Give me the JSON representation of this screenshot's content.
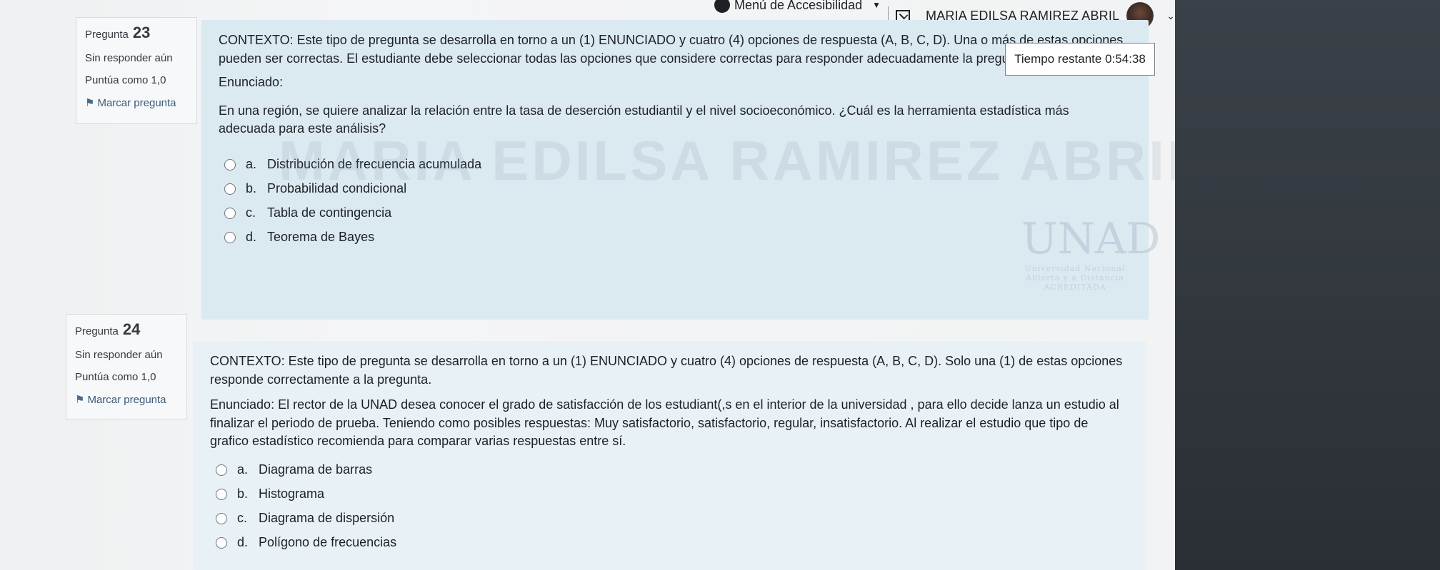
{
  "topbar": {
    "accessibility_menu": "Menú de Accesibilidad",
    "user_name": "MARIA EDILSA RAMIREZ ABRIL"
  },
  "timer": {
    "label": "Tiempo restante",
    "value": "0:54:38"
  },
  "watermark": "MARIA EDILSA RAMIREZ ABRIL",
  "logo": {
    "name": "UNAD",
    "line1": "Universidad Nacional",
    "line2": "Abierta y a Distancia",
    "badge": "ACREDITADA"
  },
  "questions": [
    {
      "label": "Pregunta",
      "number": "23",
      "status": "Sin responder aún",
      "score": "Puntúa como 1,0",
      "flag": "Marcar pregunta",
      "context": "CONTEXTO: Este tipo de pregunta se desarrolla en torno a un (1) ENUNCIADO y cuatro (4) opciones de respuesta (A, B, C, D). Una o más de estas opciones pueden ser correctas. El estudiante debe seleccionar todas las opciones que considere correctas para responder adecuadamente la pregunta.",
      "statement_label": "Enunciado:",
      "statement": "En una región, se quiere analizar la relación entre la tasa de deserción estudiantil y el nivel socioeconómico. ¿Cuál es la herramienta estadística más adecuada para este análisis?",
      "answers": [
        {
          "letter": "a.",
          "text": "Distribución de frecuencia acumulada"
        },
        {
          "letter": "b.",
          "text": "Probabilidad condicional"
        },
        {
          "letter": "c.",
          "text": "Tabla de contingencia"
        },
        {
          "letter": "d.",
          "text": "Teorema de Bayes"
        }
      ]
    },
    {
      "label": "Pregunta",
      "number": "24",
      "status": "Sin responder aún",
      "score": "Puntúa como 1,0",
      "flag": "Marcar pregunta",
      "context": "CONTEXTO: Este tipo de pregunta se desarrolla en torno a un (1) ENUNCIADO y cuatro (4) opciones de respuesta (A, B, C, D). Solo una (1) de estas opciones responde correctamente a la pregunta.",
      "statement": "Enunciado: El rector de la UNAD desea conocer el grado de satisfacción de los estudiant(,s en el interior de la universidad , para ello decide lanza un estudio al finalizar el periodo de prueba. Teniendo como posibles respuestas: Muy satisfactorio, satisfactorio, regular, insatisfactorio. Al realizar el estudio que tipo de grafico estadístico recomienda para comparar varias respuestas entre sí.",
      "answers": [
        {
          "letter": "a.",
          "text": "Diagrama de barras"
        },
        {
          "letter": "b.",
          "text": "Histograma"
        },
        {
          "letter": "c.",
          "text": "Diagrama de dispersión"
        },
        {
          "letter": "d.",
          "text": "Polígono de frecuencias"
        }
      ]
    }
  ]
}
